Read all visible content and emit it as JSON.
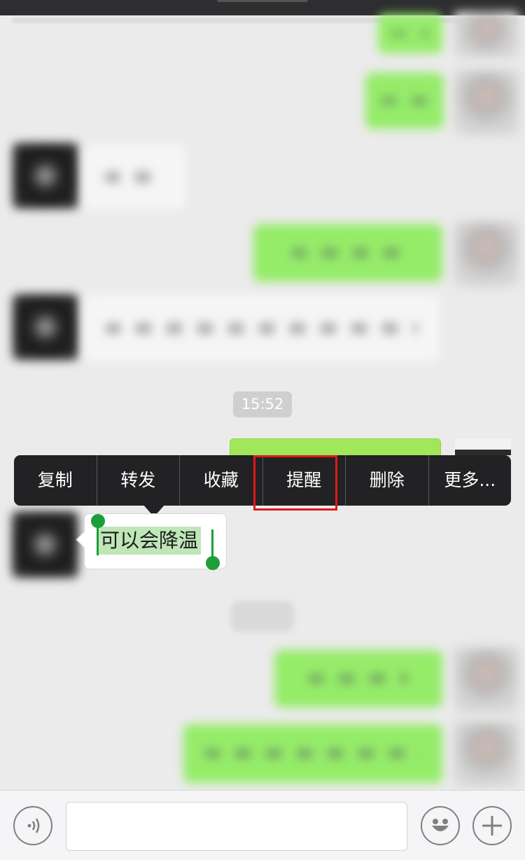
{
  "chat": {
    "timestamp": "15:52",
    "selected_message": "可以会降温"
  },
  "context_menu": {
    "items": [
      "复制",
      "转发",
      "收藏",
      "提醒",
      "删除",
      "更多..."
    ],
    "highlighted": "提醒"
  },
  "input_bar": {
    "voice_icon": "voice-icon",
    "emoji_icon": "emoji-icon",
    "more_icon": "plus-icon",
    "placeholder": ""
  },
  "colors": {
    "sent_bubble": "#95ec69",
    "received_bubble": "#ffffff",
    "menu_background": "#222224",
    "highlight_border": "#e01818",
    "selection": "#bfe6b7",
    "handle": "#1e9e3a"
  }
}
